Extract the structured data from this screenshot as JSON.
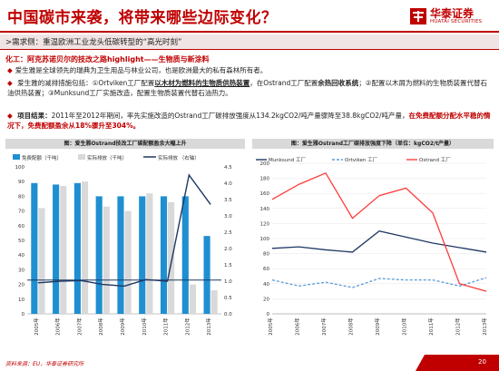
{
  "header": {
    "title": "中国碳市来袭，将带来哪些边际变化？",
    "logo_text": "华泰证券",
    "logo_sub": "HUATAI SECURITIES"
  },
  "subheader": ">需求侧：重温欧洲工业龙头低碳转型的“高光时刻”",
  "section": {
    "title": "化工：阿克苏诺贝尔的技改之路highlight——生物质与新涂料"
  },
  "bullets": [
    {
      "text": "爱生雅是全球领先的瑞典为卫生用品与林业公司，也是欧洲最大的私有森林所有者。"
    },
    {
      "parts": [
        {
          "t": "爱生雅的减排措施包括：①Ortviken工厂配置"
        },
        {
          "t": "以木材为燃料的生物质供热装置",
          "s": "under"
        },
        {
          "t": "，在Ostrand工厂配置"
        },
        {
          "t": "余热回收系统",
          "s": "bold"
        },
        {
          "t": "；②配置以木屑为燃料的生物质装置代替石油供热装置；③Munksund工厂实施改造，配置生物质装置代替石油热力。"
        }
      ]
    },
    {
      "parts": [
        {
          "t": "项目结果：",
          "s": "bold"
        },
        {
          "t": "2011年至2012年期间，率先实施改造的Ostrand工厂碳排放强度从134.2kgCO2/吨产量骤降至38.8kgCO2/吨产量，"
        },
        {
          "t": "在免费配额分配水平稳的情况下，免费配额盈余从18%骤升至304%。",
          "s": "redt"
        }
      ]
    }
  ],
  "chart1": {
    "title": "图：爱生雅Ostrand技改工厂碳配额盈余大幅上升",
    "legend": [
      "免费配额（千吨）",
      "实际排放（千吨）",
      "实际排放 （右轴）"
    ],
    "colors": {
      "free": "#1f8fd1",
      "actual": "#d9d9d9",
      "line": "#1f3864",
      "hline": "#1f3864"
    }
  },
  "chart2": {
    "title": "图：爱生雅Ostrand工厂碳排放强度下降（单位：kgCO2/t产量）",
    "legend": [
      "Munksund 工厂",
      "Ortviken 工厂",
      "Ostrand 工厂"
    ],
    "colors": {
      "munksund": "#1f3864",
      "ortviken": "#5b9bd5",
      "ostrand": "#ff3b3b"
    }
  },
  "chart_data": [
    {
      "type": "bar",
      "title": "图：爱生雅Ostrand技改工厂碳配额盈余大幅上升",
      "categories": [
        "2005年",
        "2006年",
        "2007年",
        "2008年",
        "2009年",
        "2010年",
        "2011年",
        "2012年",
        "2013年"
      ],
      "series": [
        {
          "name": "免费配额（千吨）",
          "axis": "left",
          "values": [
            89,
            88,
            89,
            80,
            80,
            80,
            80,
            80,
            53
          ]
        },
        {
          "name": "实际排放（千吨）",
          "axis": "left",
          "values": [
            72,
            87,
            90,
            73,
            70,
            82,
            76,
            20,
            16
          ]
        },
        {
          "name": "实际排放 （右轴）",
          "axis": "right",
          "type": "line",
          "values": [
            0.95,
            1.0,
            1.02,
            0.9,
            0.85,
            1.05,
            1.0,
            4.25,
            3.35
          ]
        }
      ],
      "hline_left": 23,
      "ylim_left": [
        0,
        100
      ],
      "ylim_right": [
        0,
        4.5
      ],
      "yticks_left": [
        "0",
        "10",
        "20",
        "30",
        "40",
        "50",
        "60",
        "70",
        "80",
        "90",
        "100"
      ],
      "yticks_right": [
        "0.0",
        "0.5",
        "1.0",
        "1.5",
        "2.0",
        "2.5",
        "3.0",
        "3.5",
        "4.0",
        "4.5"
      ],
      "legend": "top"
    },
    {
      "type": "line",
      "title": "图：爱生雅Ostrand工厂碳排放强度下降（单位：kgCO2/t产量）",
      "categories": [
        "2005年",
        "2006年",
        "2007年",
        "2008年",
        "2009年",
        "2010年",
        "2011年",
        "2012年",
        "2013年"
      ],
      "series": [
        {
          "name": "Munksund 工厂",
          "values": [
            87,
            89,
            85,
            82,
            110,
            102,
            94,
            88,
            82
          ]
        },
        {
          "name": "Ortviken 工厂",
          "values": [
            45,
            37,
            42,
            35,
            47,
            45,
            45,
            37,
            48
          ]
        },
        {
          "name": "Ostrand 工厂",
          "values": [
            152,
            172,
            187,
            127,
            157,
            167,
            134,
            40,
            30
          ]
        }
      ],
      "ylim": [
        0,
        200
      ],
      "yticks": [
        "0",
        "20",
        "40",
        "60",
        "80",
        "100",
        "120",
        "140",
        "160",
        "180",
        "200"
      ],
      "legend": "top"
    }
  ],
  "footer": {
    "source": "资料来源：EU，华泰证券研究所",
    "page": "20"
  }
}
